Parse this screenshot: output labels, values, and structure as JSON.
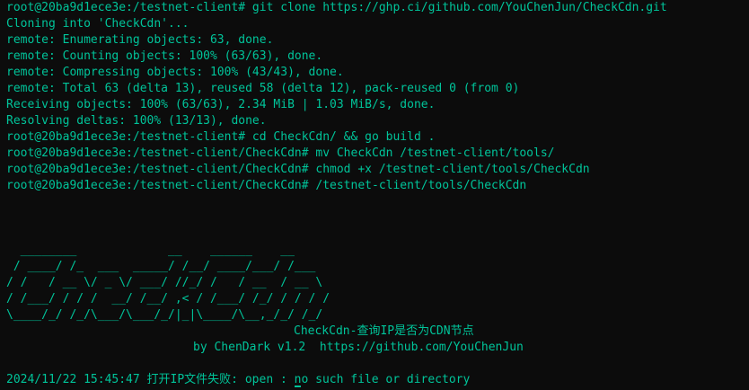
{
  "terminal": {
    "lines": [
      "root@20ba9d1ece3e:/testnet-client# git clone https://ghp.ci/github.com/YouChenJun/CheckCdn.git",
      "Cloning into 'CheckCdn'...",
      "remote: Enumerating objects: 63, done.",
      "remote: Counting objects: 100% (63/63), done.",
      "remote: Compressing objects: 100% (43/43), done.",
      "remote: Total 63 (delta 13), reused 58 (delta 12), pack-reused 0 (from 0)",
      "Receiving objects: 100% (63/63), 2.34 MiB | 1.03 MiB/s, done.",
      "Resolving deltas: 100% (13/13), done.",
      "root@20ba9d1ece3e:/testnet-client# cd CheckCdn/ && go build .",
      "root@20ba9d1ece3e:/testnet-client/CheckCdn# mv CheckCdn /testnet-client/tools/",
      "root@20ba9d1ece3e:/testnet-client/CheckCdn# chmod +x /testnet-client/tools/CheckCdn",
      "root@20ba9d1ece3e:/testnet-client/CheckCdn# /testnet-client/tools/CheckCdn"
    ],
    "banner": [
      "  ________             __    ______    __",
      " / ____/ /_  ___  _____/ /__/ ____/___/ /___",
      "/ /   / __ \\/ _ \\/ ___/ //_/ /   / __  / __ \\",
      "/ /___/ / / /  __/ /__/ ,< / /___/ /_/ / / / /",
      "\\____/_/ /_/\\___/\\___/_/|_|\\____/\\__,_/_/ /_/"
    ],
    "tagline": "CheckCdn-查询IP是否为CDN节点",
    "credit": "by ChenDark v1.2  https://github.com/YouChenJun",
    "error_before_cursor": "2024/11/22 15:45:47 打开IP文件失败: open : ",
    "error_cursor_char": "n",
    "error_after_cursor": "o such file or directory",
    "colors": {
      "background": "#0c0c0c",
      "text": "#00c49a"
    }
  }
}
